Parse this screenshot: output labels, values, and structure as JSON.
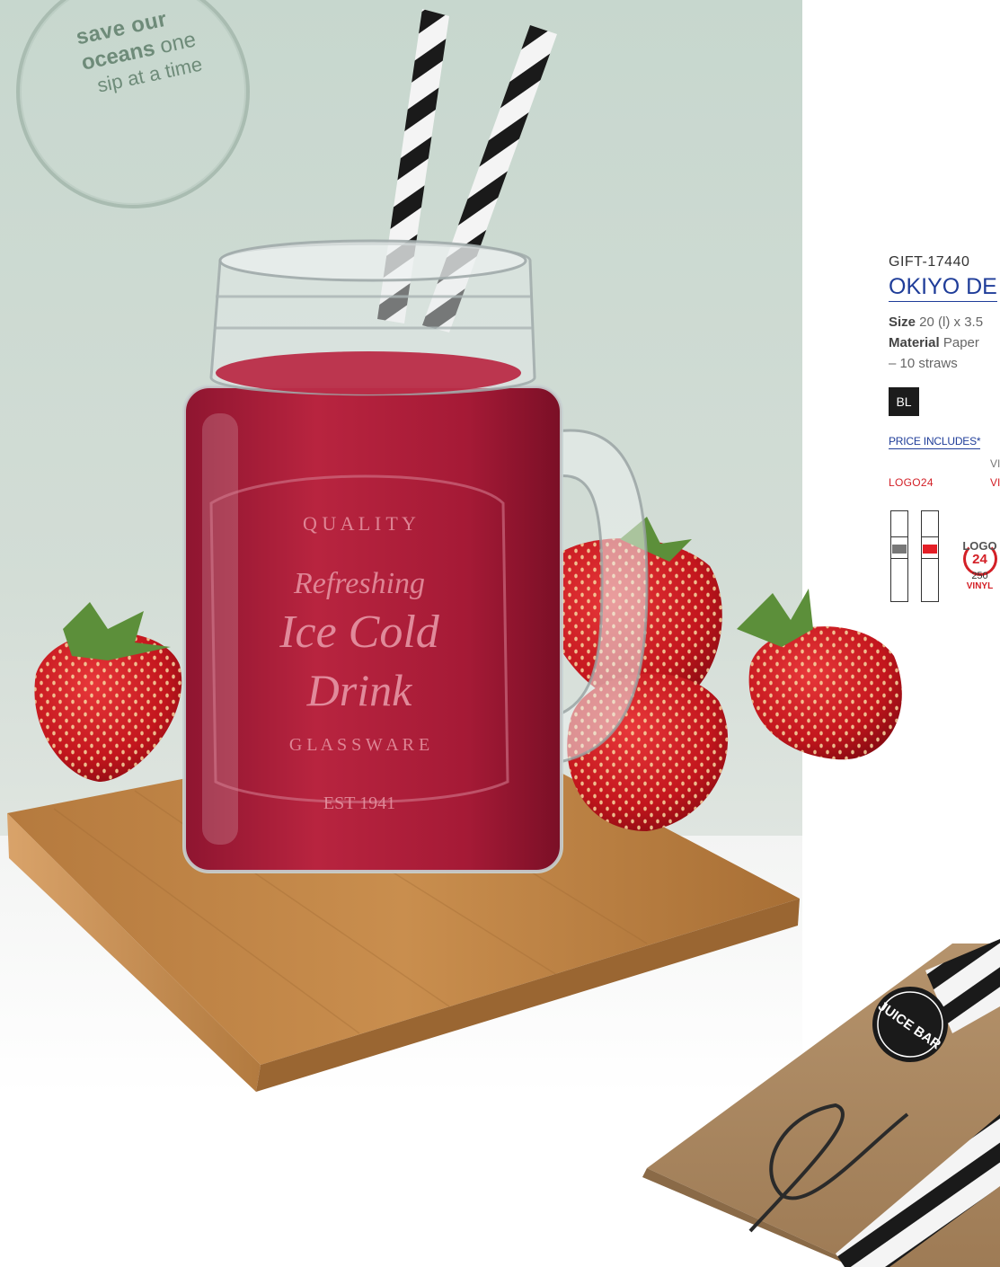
{
  "badge": {
    "line1": "save our",
    "line2_bold": "oceans",
    "line2_light": " one",
    "line3": "sip at a time"
  },
  "product": {
    "code": "GIFT-17440",
    "name": "OKIYO DE",
    "size_label": "Size",
    "size_value": " 20 (l) x 3.5",
    "material_label": "Material",
    "material_value": " Paper",
    "pack": "– 10 straws",
    "colour_code": "BL"
  },
  "pricing": {
    "price_includes": "PRICE INCLUDES*",
    "vi_1": "VI",
    "vi_2": "VI",
    "logo_label": "LOGO24"
  },
  "branding": {
    "logo_word": "LOGO",
    "logo_num": "24",
    "qty": "250",
    "method": "VINYL",
    "position_colors": [
      "#777777",
      "#e41e26"
    ]
  },
  "jar_text": {
    "line1": "Q U A L I T Y",
    "line2": "Refreshing",
    "line3": "Ice Cold",
    "line4": "Drink",
    "line5": "G L A S S W A R E",
    "line6": "EST 1941"
  },
  "box_logo": {
    "text": "JUICE BAR"
  }
}
